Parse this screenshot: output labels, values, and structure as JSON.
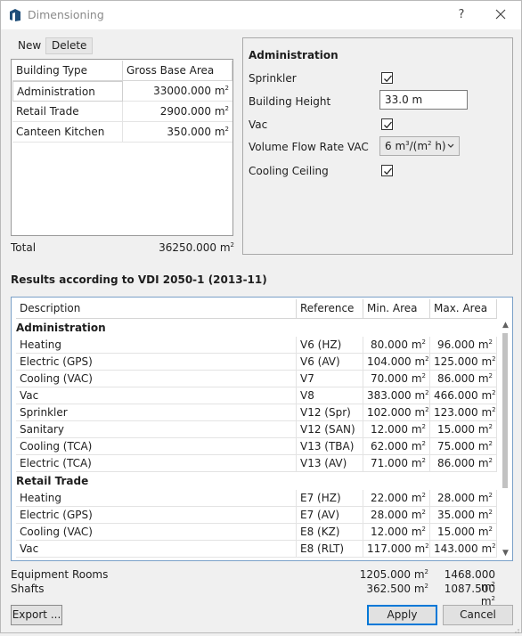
{
  "window": {
    "title": "Dimensioning",
    "help_label": "?",
    "close_icon": "close-icon",
    "app_icon": "app-logo-icon"
  },
  "toolbar": {
    "new_label": "New",
    "delete_label": "Delete"
  },
  "building_table": {
    "headers": [
      "Building Type",
      "Gross Base Area"
    ],
    "rows": [
      {
        "type": "Administration",
        "area": "33000.000 m",
        "unit_sup": "2"
      },
      {
        "type": "Retail Trade",
        "area": "2900.000 m",
        "unit_sup": "2"
      },
      {
        "type": "Canteen Kitchen",
        "area": "350.000 m",
        "unit_sup": "2"
      }
    ],
    "selected_row": 0
  },
  "total": {
    "label": "Total",
    "value": "36250.000 m",
    "unit_sup": "2"
  },
  "properties": {
    "title": "Administration",
    "sprinkler_label": "Sprinkler",
    "sprinkler_checked": true,
    "height_label": "Building Height",
    "height_value": "33.0 m",
    "vac_label": "Vac",
    "vac_checked": true,
    "flow_label": "Volume Flow Rate VAC",
    "flow_value_pre": "6 m",
    "flow_value_sup": "3",
    "flow_value_post": "/(m",
    "flow_value_sup2": "2",
    "flow_value_end": " h)",
    "cooling_label": "Cooling Ceiling",
    "cooling_checked": true
  },
  "results": {
    "title": "Results according to VDI 2050-1 (2013-11)",
    "headers": [
      "Description",
      "Reference",
      "Min. Area",
      "Max. Area"
    ],
    "unit": "m",
    "unit_sup": "2",
    "groups": [
      {
        "name": "Administration",
        "rows": [
          {
            "description": "Heating",
            "reference": "V6 (HZ)",
            "min": "80.000",
            "max": "96.000"
          },
          {
            "description": "Electric (GPS)",
            "reference": "V6 (AV)",
            "min": "104.000",
            "max": "125.000"
          },
          {
            "description": "Cooling (VAC)",
            "reference": "V7",
            "min": "70.000",
            "max": "86.000"
          },
          {
            "description": "Vac",
            "reference": "V8",
            "min": "383.000",
            "max": "466.000"
          },
          {
            "description": "Sprinkler",
            "reference": "V12 (Spr)",
            "min": "102.000",
            "max": "123.000"
          },
          {
            "description": "Sanitary",
            "reference": "V12 (SAN)",
            "min": "12.000",
            "max": "15.000"
          },
          {
            "description": "Cooling (TCA)",
            "reference": "V13 (TBA)",
            "min": "62.000",
            "max": "75.000"
          },
          {
            "description": "Electric (TCA)",
            "reference": "V13 (AV)",
            "min": "71.000",
            "max": "86.000"
          }
        ]
      },
      {
        "name": "Retail Trade",
        "rows": [
          {
            "description": "Heating",
            "reference": "E7 (HZ)",
            "min": "22.000",
            "max": "28.000"
          },
          {
            "description": "Electric (GPS)",
            "reference": "E7 (AV)",
            "min": "28.000",
            "max": "35.000"
          },
          {
            "description": "Cooling (VAC)",
            "reference": "E8 (KZ)",
            "min": "12.000",
            "max": "15.000"
          },
          {
            "description": "Vac",
            "reference": "E8 (RLT)",
            "min": "117.000",
            "max": "143.000"
          }
        ]
      }
    ]
  },
  "summary": {
    "equipment_label": "Equipment Rooms",
    "equipment_min": "1205.000 m",
    "equipment_max": "1468.000 m",
    "shafts_label": "Shafts",
    "shafts_min": "362.500 m",
    "shafts_max": "1087.500 m",
    "unit_sup": "2"
  },
  "buttons": {
    "export_label": "Export ...",
    "apply_label": "Apply",
    "cancel_label": "Cancel"
  },
  "colors": {
    "accent": "#0078d7",
    "table_border": "#7aa0c8",
    "title_text": "#8a8a8a"
  }
}
